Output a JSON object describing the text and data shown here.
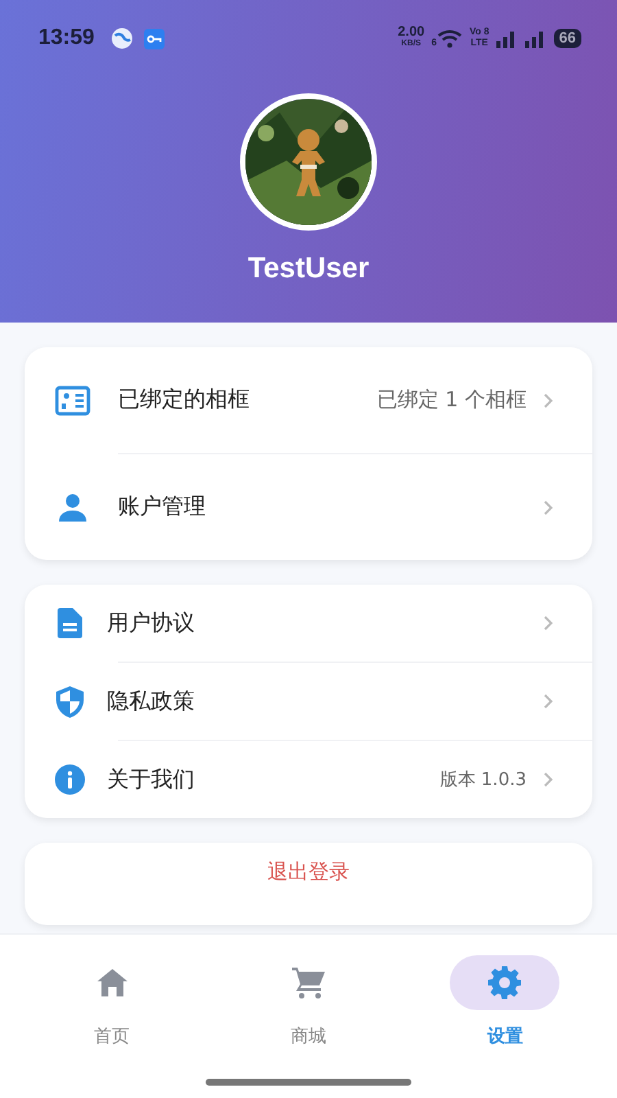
{
  "status_bar": {
    "time": "13:59",
    "speed_value": "2.00",
    "speed_unit": "KB/S",
    "wifi_label": "6",
    "volte": "Vo 8",
    "lte": "LTE",
    "battery": "66"
  },
  "profile": {
    "username": "TestUser"
  },
  "groups": [
    {
      "items": [
        {
          "kind": "card",
          "label": "已绑定的相框",
          "value": "已绑定 1 个相框"
        },
        {
          "kind": "person",
          "label": "账户管理"
        }
      ]
    },
    {
      "items": [
        {
          "kind": "document",
          "label": "用户协议"
        },
        {
          "kind": "shield",
          "label": "隐私政策"
        },
        {
          "kind": "info",
          "label": "关于我们",
          "value": "版本 1.0.3"
        }
      ]
    }
  ],
  "logout": {
    "label": "退出登录"
  },
  "bottom_nav": [
    {
      "kind": "home",
      "label": "首页",
      "selected": false
    },
    {
      "kind": "cart",
      "label": "商城",
      "selected": false
    },
    {
      "kind": "settings",
      "label": "设置",
      "selected": true
    }
  ]
}
